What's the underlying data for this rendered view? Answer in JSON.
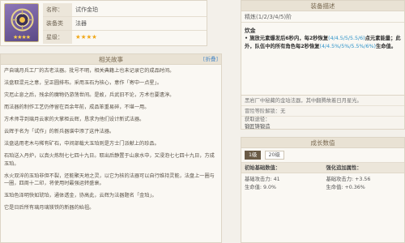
{
  "info": {
    "name_key": "名称：",
    "name_value": "试作金珀",
    "type_key": "装备类型：",
    "type_value": "法器",
    "rarity_key": "星级：",
    "rarity_value": "★★★★",
    "icon_stars": "★★★★"
  },
  "story": {
    "title": "相关故事",
    "edit_label": "[折叠]",
    "paragraphs": [
      "产自璃月兵工厂的古老法器。批号不明，相关典籍上也未记录它的成品时间。",
      "法盘取混元之意，呈正圆排布。采用玉石为核心，意作「寄中一点星」。",
      "灾厄止息之后，残余的魔物仍游荡世间。是故，兵武旧不论，方术也要遗淳。",
      "而法器的制作工艺仍停留在百余年前，成品笨重易碎，不堪一用。",
      "方术师寻到璃月云家的大掌柜云辉，恳求为他们设计新式法器。",
      "云辉于名为「试作」的新兵器谱中添了这件法器。",
      "法盘选用老木与稀有矿石，中间部载大玉珀则是方士门派献上的珍品。",
      "石珀送入丹炉，以真火炼制七七四十九日。取出后静置于山泉水中，又浸泡七七四十九日，方成玉珀。",
      "水火双淬的玉珀非但不裂，还能聚天地之灵，以它为核的法器可以自行维持灵能，法盘上一圈与一圈，四周十二印，将使用时最强运转盛衰。",
      "玉珀色泽明快如琥珀，通体透金，协高此，云辉为法器题名「金珀」。",
      "它是日后所有璃月璃镁铁的新器的始祖。"
    ]
  },
  "skill": {
    "title": "装备描述",
    "refine": "精炼(1/2/3/4/5)阶",
    "name": "炊金",
    "line1_a": "• 施放元素爆发后6秒内，每2秒恢复",
    "line1_hl": "(4/4.5/5/5.5/6)",
    "line1_b": "点元素能量；此外，队伍中的所有角色每2秒恢复",
    "line1_hl2": "(4/4.5%/5%/5.5%/6%)",
    "line1_c": "生命值。",
    "desc": "黑岩厂中秘藏的金珀法器，其中翻腾故着日月星光。"
  },
  "fate": {
    "acquire": "冒险等阶解锁：无",
    "source_title": "获取途径：",
    "source": "锻匠铸锻造"
  },
  "growth": {
    "title": "成长数值",
    "tab1": "1级",
    "tab2": "20级",
    "col1_title": "初始基础数值：",
    "col2_title": "强化追加属性：",
    "col1_line1": "基础攻击力: 41",
    "col1_line2": "生命值: 9.0%",
    "col2_line1": "基础攻击力: +3.56",
    "col2_line2": "生命值: +0.36%"
  }
}
